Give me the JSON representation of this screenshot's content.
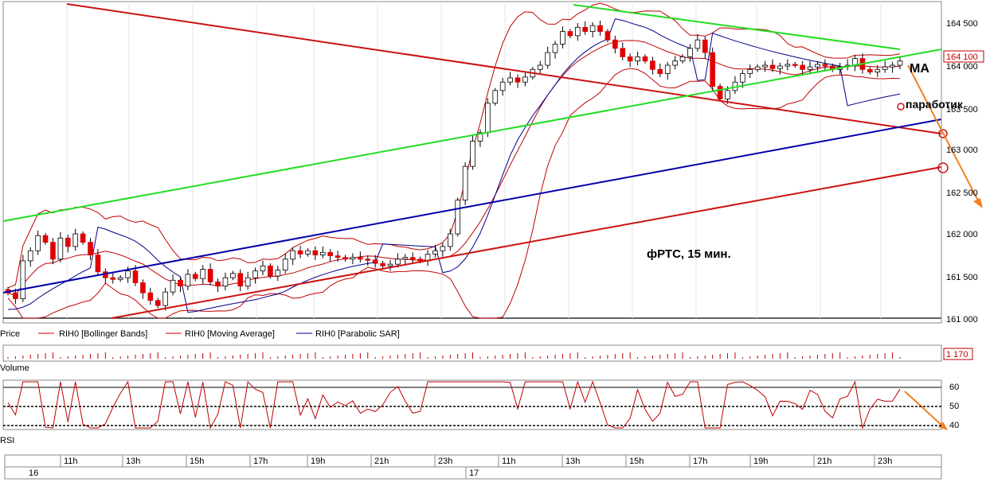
{
  "panels": {
    "price": {
      "label": "Price"
    },
    "volume": {
      "label": "Volume",
      "last_value": "1 170"
    },
    "rsi": {
      "label": "RSI"
    }
  },
  "legend": [
    {
      "text": "RIH0 [Bollinger Bands]",
      "color": "#c00000"
    },
    {
      "text": "RIH0 [Moving Average]",
      "color": "#c00000"
    },
    {
      "text": "RIH0 [Parabolic SAR]",
      "color": "#00008b"
    }
  ],
  "annotations": {
    "title": "фРТС,   15 мин.",
    "ma": "MA",
    "parabolic": "паработик"
  },
  "price_axis": {
    "ticks": [
      "164 500",
      "164 000",
      "163 500",
      "163 000",
      "162 500",
      "162 000",
      "161 500",
      "161 000"
    ],
    "current": "164 100"
  },
  "rsi_axis": {
    "ticks": [
      "60",
      "50",
      "40"
    ]
  },
  "time_axis": {
    "hours": [
      "11h",
      "13h",
      "15h",
      "17h",
      "19h",
      "21h",
      "23h",
      "11h",
      "13h",
      "15h",
      "17h",
      "19h",
      "21h",
      "23h"
    ],
    "days": [
      "16",
      "17"
    ]
  },
  "colors": {
    "bull": "#ffffff",
    "bear": "#e00000",
    "bollinger": "#c00000",
    "sar": "#00008b",
    "green_line": "#22dd22",
    "blue_line": "#0000aa",
    "red_line": "#cc1111",
    "arrow": "#f08020"
  },
  "chart_data": {
    "type": "candlestick",
    "instrument": "RIH0",
    "ylim": [
      161000,
      164650
    ],
    "close": [
      161300,
      161230,
      161680,
      161800,
      161980,
      161900,
      161700,
      161950,
      161850,
      162000,
      161900,
      161750,
      161550,
      161480,
      161460,
      161480,
      161560,
      161420,
      161300,
      161210,
      161150,
      161310,
      161450,
      161380,
      161520,
      161470,
      161580,
      161430,
      161380,
      161480,
      161530,
      161380,
      161480,
      161560,
      161620,
      161500,
      161570,
      161700,
      161800,
      161760,
      161800,
      161750,
      161780,
      161740,
      161720,
      161700,
      161720,
      161700,
      161690,
      161650,
      161620,
      161640,
      161700,
      161720,
      161700,
      161680,
      161760,
      161800,
      161850,
      162000,
      162400,
      162800,
      163100,
      163200,
      163550,
      163700,
      163800,
      163850,
      163800,
      163860,
      163950,
      164000,
      164150,
      164250,
      164400,
      164350,
      164450,
      164400,
      164470,
      164400,
      164300,
      164200,
      164100,
      164050,
      164100,
      164050,
      163950,
      163900,
      164000,
      164050,
      164100,
      164200,
      164300,
      164150,
      163750,
      163600,
      163700,
      163800,
      163900,
      163950,
      163980,
      164000,
      163960,
      163990,
      164010,
      164000,
      163950,
      163980,
      164010,
      163990,
      163950,
      163980,
      164000,
      164080,
      163950,
      163920,
      163950,
      163980,
      164000,
      164050
    ]
  }
}
